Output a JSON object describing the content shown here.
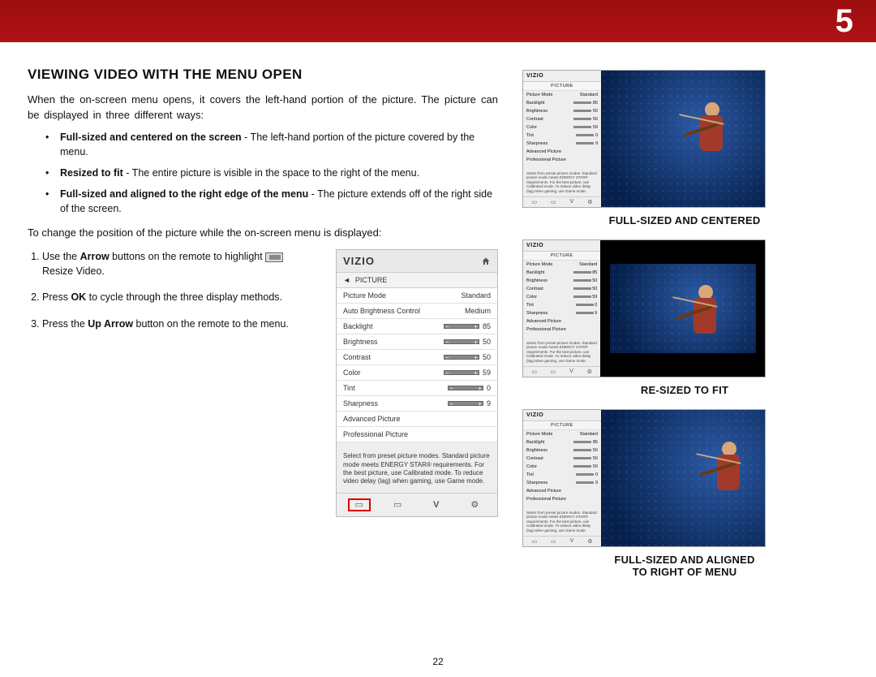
{
  "chapter_number": "5",
  "page_number": "22",
  "section_title": "VIEWING VIDEO WITH THE MENU OPEN",
  "intro": "When the on-screen menu opens, it covers the left-hand portion of the picture. The picture can be displayed in three different ways:",
  "bullets": [
    {
      "bold": "Full-sized and centered on the screen",
      "rest": " - The left-hand portion of the picture covered by the menu."
    },
    {
      "bold": "Resized to fit",
      "rest": " - The entire picture is visible in the space to the right of the menu."
    },
    {
      "bold": "Full-sized and aligned to the right edge of the menu",
      "rest": " - The picture extends off of the right side of the screen."
    }
  ],
  "change_para": "To change the position of the picture while the on-screen menu is displayed:",
  "steps": {
    "s1_a": "Use the ",
    "s1_b": "Arrow",
    "s1_c": " buttons on the remote to highlight ",
    "s1_d": " Resize Video.",
    "s2_a": "Press ",
    "s2_b": "OK",
    "s2_c": " to cycle through the three display methods.",
    "s3_a": "Press the ",
    "s3_b": "Up Arrow",
    "s3_c": " button on the remote to the menu."
  },
  "menu": {
    "brand": "VIZIO",
    "sub": "PICTURE",
    "rows": [
      {
        "label": "Picture Mode",
        "value": "Standard",
        "type": "text"
      },
      {
        "label": "Auto Brightness Control",
        "value": "Medium",
        "type": "text"
      },
      {
        "label": "Backlight",
        "value": "85",
        "type": "slider"
      },
      {
        "label": "Brightness",
        "value": "50",
        "type": "slider"
      },
      {
        "label": "Contrast",
        "value": "50",
        "type": "slider"
      },
      {
        "label": "Color",
        "value": "59",
        "type": "slider"
      },
      {
        "label": "Tint",
        "value": "0",
        "type": "slider"
      },
      {
        "label": "Sharpness",
        "value": "9",
        "type": "slider"
      },
      {
        "label": "Advanced Picture",
        "value": "",
        "type": "simple"
      },
      {
        "label": "Professional Picture",
        "value": "",
        "type": "simple"
      }
    ],
    "help": "Select from preset picture modes. Standard picture mode meets ENERGY STAR® requirements. For the best picture, use Calibrated mode. To reduce video delay (lag) when gaming, use Game mode."
  },
  "mini_menu": {
    "brand": "VIZIO",
    "sub": "PICTURE",
    "rows": [
      {
        "label": "Picture Mode",
        "value": "Standard"
      },
      {
        "label": "Backlight",
        "value": "85"
      },
      {
        "label": "Brightness",
        "value": "50"
      },
      {
        "label": "Contrast",
        "value": "50"
      },
      {
        "label": "Color",
        "value": "59"
      },
      {
        "label": "Tint",
        "value": "0"
      },
      {
        "label": "Sharpness",
        "value": "9"
      },
      {
        "label": "Advanced Picture",
        "value": ""
      },
      {
        "label": "Professional Picture",
        "value": ""
      }
    ],
    "help": "Select from preset picture modes. Standard picture mode meets ENERGY STAR® requirements. For the best picture, use Calibrated mode. To reduce video delay (lag) when gaming, use Game mode."
  },
  "captions": {
    "c1": "FULL-SIZED AND CENTERED",
    "c2": "RE-SIZED TO FIT",
    "c3a": "FULL-SIZED AND ALIGNED",
    "c3b": "TO RIGHT OF MENU"
  }
}
